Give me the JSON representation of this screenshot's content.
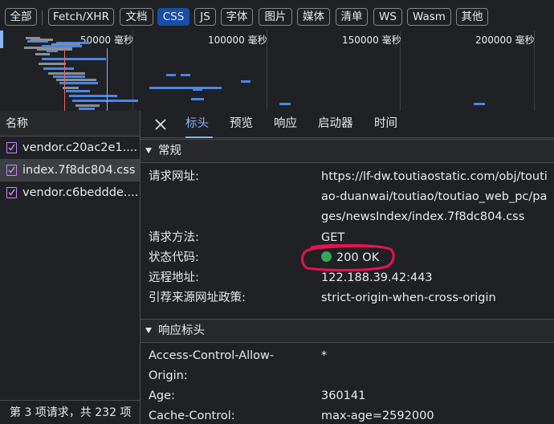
{
  "filters": [
    {
      "label": "全部",
      "active": false
    },
    {
      "label": "Fetch/XHR",
      "active": false
    },
    {
      "label": "文档",
      "active": false
    },
    {
      "label": "CSS",
      "active": true
    },
    {
      "label": "JS",
      "active": false
    },
    {
      "label": "字体",
      "active": false
    },
    {
      "label": "图片",
      "active": false
    },
    {
      "label": "媒体",
      "active": false
    },
    {
      "label": "清单",
      "active": false
    },
    {
      "label": "WS",
      "active": false
    },
    {
      "label": "Wasm",
      "active": false
    },
    {
      "label": "其他",
      "active": false
    }
  ],
  "timeline": {
    "ticks": [
      "50000 毫秒",
      "100000 毫秒",
      "150000 毫秒",
      "200000 毫秒"
    ],
    "colors": {
      "bar": "#4a86e8",
      "dim_bar": "#8a8f94",
      "red_marker": "#e46962",
      "blue_marker": "#8ab4f8"
    }
  },
  "list": {
    "header": "名称",
    "files": [
      {
        "name": "vendor.c20ac2e1....",
        "selected": false
      },
      {
        "name": "index.7f8dc804.css",
        "selected": true
      },
      {
        "name": "vendor.c6beddde....",
        "selected": false
      }
    ],
    "footer": "第 3 项请求，共 232 项"
  },
  "detail": {
    "tabs": [
      "标头",
      "预览",
      "响应",
      "启动器",
      "时间"
    ],
    "active_tab": "标头",
    "general": {
      "title": "常规",
      "request_url_label": "请求网址:",
      "request_url_lines": [
        "https://lf-dw.toutiaostatic.com/obj/touti",
        "ao-duanwai/toutiao/toutiao_web_pc/pa",
        "ges/newsIndex/index.7f8dc804.css"
      ],
      "method_label": "请求方法:",
      "method_value": "GET",
      "status_label": "状态代码:",
      "status_value": "200 OK",
      "remote_label": "远程地址:",
      "remote_value": "122.188.39.42:443",
      "referrer_label": "引荐来源网址政策:",
      "referrer_value": "strict-origin-when-cross-origin"
    },
    "response": {
      "title": "响应标头",
      "acao_label_1": "Access-Control-Allow-",
      "acao_label_2": "Origin:",
      "acao_value": "*",
      "age_label": "Age:",
      "age_value": "360141",
      "cache_label": "Cache-Control:",
      "cache_value": "max-age=2592000"
    },
    "colors": {
      "status_ok": "#34a853",
      "annotation": "#e8134f",
      "accent": "#8ab4f8"
    }
  }
}
